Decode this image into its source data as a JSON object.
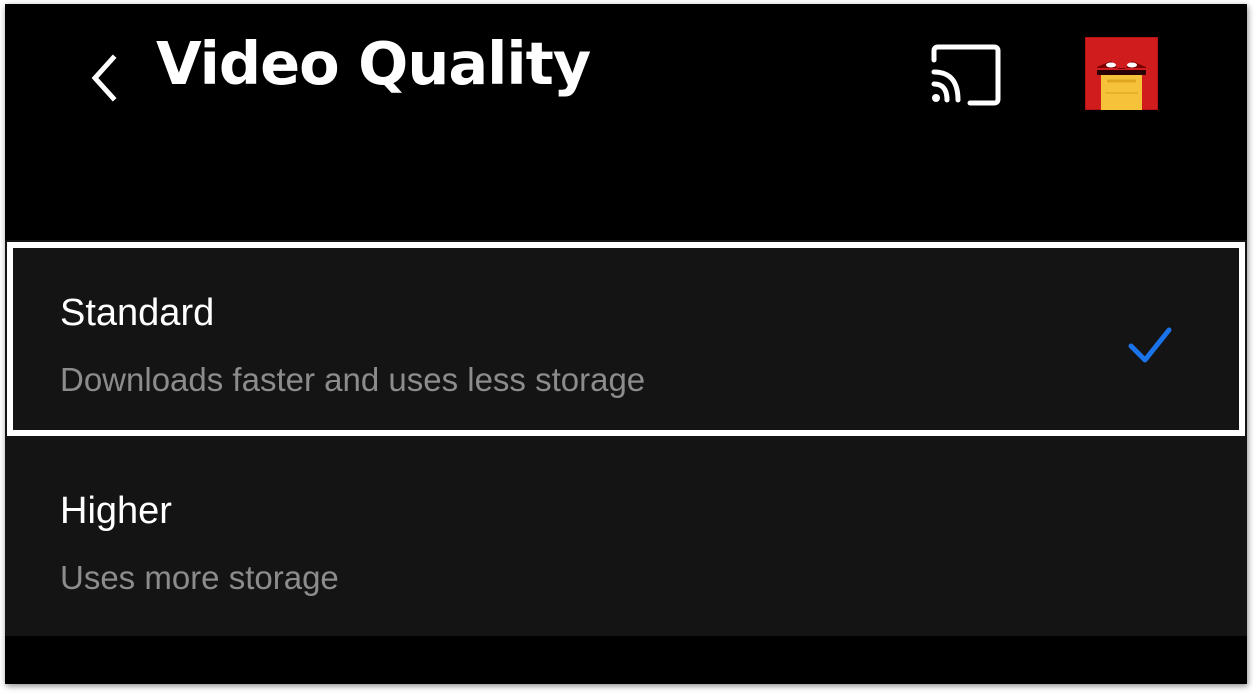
{
  "header": {
    "title": "Video Quality",
    "back_icon": "chevron-left-icon",
    "cast_icon": "cast-icon",
    "avatar_icon": "profile-avatar"
  },
  "options": [
    {
      "title": "Standard",
      "description": "Downloads faster and uses less storage",
      "selected": true
    },
    {
      "title": "Higher",
      "description": "Uses more storage",
      "selected": false
    }
  ],
  "colors": {
    "background": "#000000",
    "row_background": "#141414",
    "check_accent": "#1a73e8",
    "primary_text": "#ffffff",
    "secondary_text": "#8c8c8c",
    "focus_outline": "#ffffff"
  }
}
